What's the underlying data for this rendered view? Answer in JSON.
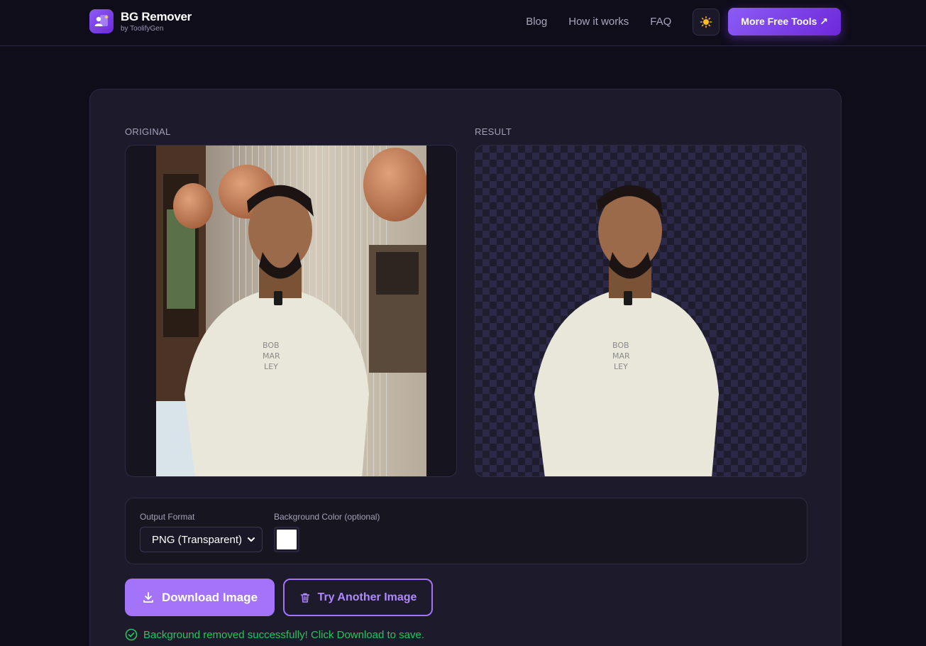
{
  "header": {
    "brand_title": "BG Remover",
    "brand_sub": "by ToolifyGen",
    "nav": [
      "Blog",
      "How it works",
      "FAQ"
    ],
    "theme_icon": "sun-icon",
    "cta_label": "More Free Tools ↗"
  },
  "main": {
    "original_label": "ORIGINAL",
    "result_label": "RESULT",
    "options": {
      "format_label": "Output Format",
      "format_value": "PNG (Transparent)",
      "bg_color_label": "Background Color (optional)",
      "bg_color_value": "#ffffff"
    },
    "download_label": "Download Image",
    "try_another_label": "Try Another Image",
    "status_text": "Background removed successfully! Click Download to save."
  },
  "colors": {
    "accent": "#8b5cf6",
    "accent_button": "#a374f9",
    "success": "#22c55e",
    "background": "#0f0d1a",
    "card": "#1d1a2b"
  }
}
